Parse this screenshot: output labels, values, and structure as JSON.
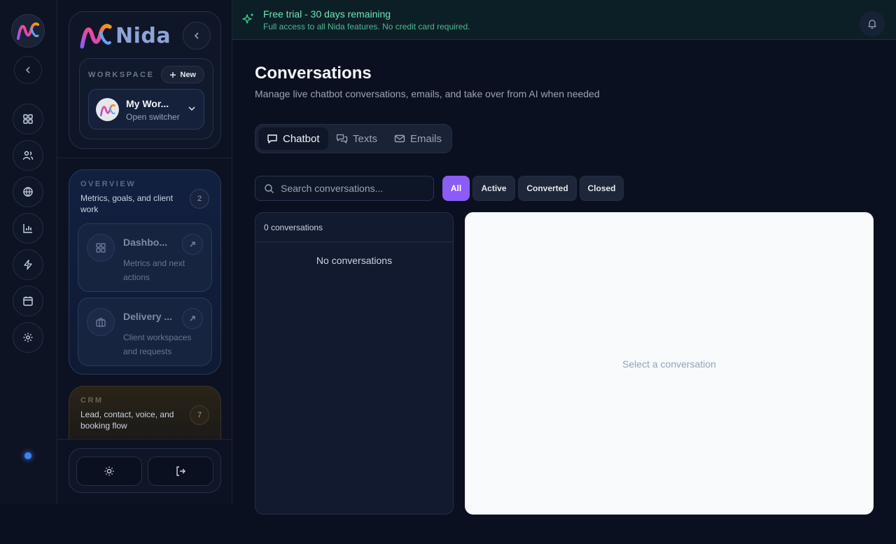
{
  "brand": {
    "name": "Nida",
    "accent": "#8b5cf6"
  },
  "rail": {
    "icons": [
      "dashboard-icon",
      "users-icon",
      "globe-icon",
      "bar-chart-icon",
      "zap-icon",
      "calendar-icon",
      "settings-icon"
    ]
  },
  "workspace": {
    "label": "WORKSPACE",
    "new_label": "New",
    "name": "My Wor...",
    "switcher_label": "Open switcher"
  },
  "groups": {
    "overview": {
      "label": "OVERVIEW",
      "description": "Metrics, goals, and client work",
      "count": "2",
      "items": [
        {
          "title": "Dashbo...",
          "subtitle": "Metrics and next actions"
        },
        {
          "title": "Delivery ...",
          "subtitle": "Client workspaces and requests"
        }
      ]
    },
    "crm": {
      "label": "CRM",
      "description": "Lead, contact, voice, and booking flow",
      "count": "7"
    }
  },
  "banner": {
    "title": "Free trial - 30 days remaining",
    "subtitle": "Full access to all Nida features. No credit card required."
  },
  "page": {
    "title": "Conversations",
    "subtitle": "Manage live chatbot conversations, emails, and take over from AI when needed"
  },
  "tabs": [
    {
      "label": "Chatbot",
      "active": true
    },
    {
      "label": "Texts",
      "active": false
    },
    {
      "label": "Emails",
      "active": false
    }
  ],
  "search": {
    "placeholder": "Search conversations...",
    "value": ""
  },
  "filters": [
    {
      "label": "All",
      "active": true
    },
    {
      "label": "Active",
      "active": false
    },
    {
      "label": "Converted",
      "active": false
    },
    {
      "label": "Closed",
      "active": false
    }
  ],
  "list": {
    "count_label": "0 conversations",
    "empty_label": "No conversations"
  },
  "detail": {
    "empty_label": "Select a conversation"
  }
}
